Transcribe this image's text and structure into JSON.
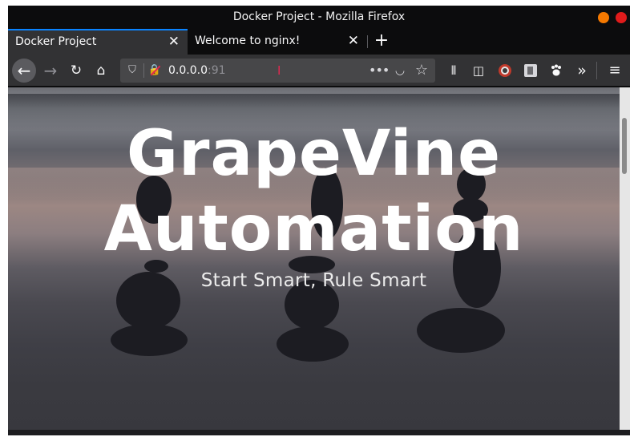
{
  "window": {
    "title": "Docker Project - Mozilla Firefox"
  },
  "tabs": [
    {
      "label": "Docker Project",
      "active": true
    },
    {
      "label": "Welcome to nginx!",
      "active": false
    }
  ],
  "tab_close_glyph": "✕",
  "new_tab_glyph": "+",
  "navbar": {
    "url_host": "0.0.0.0",
    "url_port": ":91",
    "back_icon": "←",
    "forward_icon": "→",
    "reload_icon": "↻",
    "home_icon": "⌂",
    "shield_icon": "⛉",
    "lock_icon": "🔒",
    "more_icon": "•••",
    "pocket_icon": "◡",
    "star_icon": "☆",
    "library_icon": "⫴",
    "sidebar_icon": "◫",
    "overflow_icon": "»",
    "menu_icon": "≡"
  },
  "hero": {
    "title_line1": "GrapeVine",
    "title_line2": "Automation",
    "subtitle": "Start Smart, Rule Smart"
  },
  "colors": {
    "accent": "#0a84ff",
    "minimize": "#f57900",
    "close": "#e01b1b"
  }
}
